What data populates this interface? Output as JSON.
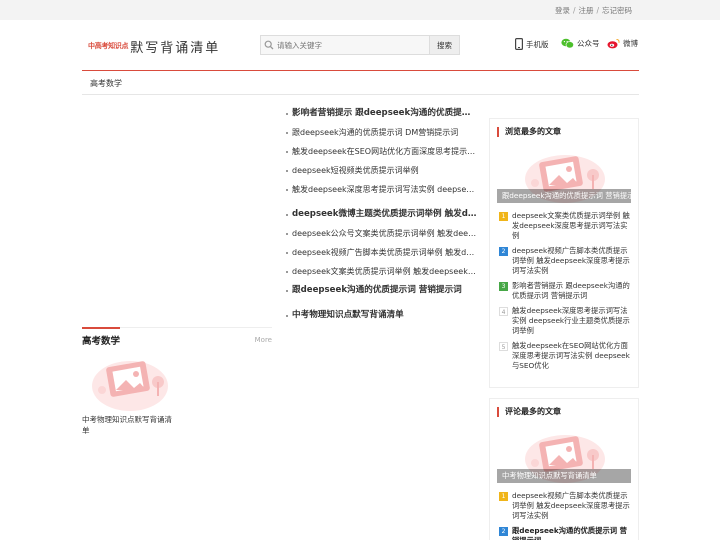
{
  "topbar": {
    "login": "登录",
    "register": "注册",
    "forgot": "忘记密码",
    "sep": "/"
  },
  "logo": {
    "small": "中高考知识点",
    "big": "默写背诵清单"
  },
  "search": {
    "placeholder": "请输入关键字",
    "button": "搜索"
  },
  "quick_links": {
    "mobile": "手机版",
    "wechat": "公众号",
    "weibo": "微博"
  },
  "nav": {
    "tab": "高考数学"
  },
  "list1": [
    {
      "text": "影响者营销提示 跟deepseek沟通的优质提示词 营销提示词",
      "head": true
    },
    {
      "text": "跟deepseek沟通的优质提示词 DM营销提示词"
    },
    {
      "text": "触发deepseek在SEO网站优化方面深度思考提示词写法实例"
    },
    {
      "text": "deepseek短视频类优质提示词举例"
    },
    {
      "text": "触发deepseek深度思考提示词写法实例 deepseek行业主题类优质提示词举例"
    }
  ],
  "list2": [
    {
      "text": "deepseek微博主题类优质提示词举例 触发deepseek深度思考提示词写法实例",
      "head": true
    },
    {
      "text": "deepseek公众号文案类优质提示词举例 触发deepseek深度思考提示词写法实例"
    },
    {
      "text": "deepseek视频广告脚本类优质提示词举例 触发deepseek深度思考提示词写法实例"
    },
    {
      "text": "deepseek文案类优质提示词举例 触发deepseek深度思考提示词写法实例"
    },
    {
      "text": "跟deepseek沟通的优质提示词 营销提示词",
      "head": true
    }
  ],
  "list3": [
    {
      "text": "中考物理知识点默写背诵清单",
      "head": true
    }
  ],
  "most_viewed": {
    "title": "浏览最多的文章",
    "thumb_caption": "跟deepseek沟通的优质提示词 营销提示词",
    "items": [
      {
        "num": "1",
        "text": "deepseek文案类优质提示词举例 触发deepseek深度思考提示词写法实例"
      },
      {
        "num": "2",
        "text": "deepseek视频广告脚本类优质提示词举例 触发deepseek深度思考提示词写法实例"
      },
      {
        "num": "3",
        "text": "影响者营销提示 跟deepseek沟通的优质提示词 营销提示词"
      },
      {
        "num": "4",
        "text": "触发deepseek深度思考提示词写法实例 deepseek行业主题类优质提示词举例"
      },
      {
        "num": "5",
        "text": "触发deepseek在SEO网站优化方面深度思考提示词写法实例 deepseek与SEO优化"
      }
    ]
  },
  "most_commented": {
    "title": "评论最多的文章",
    "thumb_caption": "中考物理知识点默写背诵清单",
    "items": [
      {
        "num": "1",
        "text": "deepseek视频广告脚本类优质提示词举例 触发deepseek深度思考提示词写法实例"
      },
      {
        "num": "2",
        "text": "跟deepseek沟通的优质提示词 营销提示词"
      }
    ]
  },
  "gaokao": {
    "title": "高考数学",
    "more": "More",
    "card_caption": "中考物理知识点默写背诵清单"
  },
  "colors": {
    "accent": "#d94b3c",
    "placeholder_pink": "#f6c8c8"
  }
}
